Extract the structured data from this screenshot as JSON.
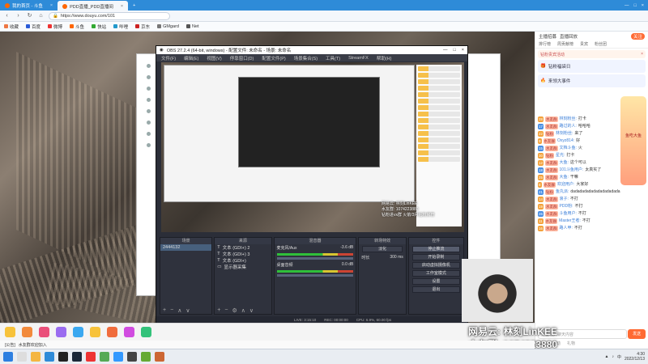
{
  "browser": {
    "tabs": [
      {
        "label": "我的首页 - 斗鱼",
        "active": false
      },
      {
        "label": "PDD直播_PDD直播间",
        "active": true
      }
    ],
    "url": "https://www.douyu.com/101",
    "bookmarks": [
      "收藏",
      "百度",
      "微博",
      "斗鱼",
      "快站",
      "哔哩",
      "京东",
      "GMgard",
      "Net"
    ]
  },
  "obs": {
    "title": "OBS 27.2.4 (64-bit, windows) - 配置文件: 未命名 - 场景: 未命名",
    "menu": [
      "文件(F)",
      "编辑(E)",
      "视图(V)",
      "停靠窗口(D)",
      "配置文件(P)",
      "场景集合(S)",
      "工具(T)",
      "StreamFX",
      "帮助(H)"
    ],
    "docks": {
      "scenes": {
        "header": "场景",
        "items": [
          "2444132"
        ]
      },
      "sources": {
        "header": "来源",
        "items": [
          "文本 (GDI+) 2",
          "文本 (GDI+) 3",
          "文本 (GDI+)",
          "显示器采集"
        ]
      },
      "mixer": {
        "header": "混音器",
        "items": [
          {
            "name": "麦克风/Aux",
            "db": "-3.6 dB"
          },
          {
            "name": "桌面音频",
            "db": "0.0 dB"
          }
        ]
      },
      "transitions": {
        "header": "转场特效",
        "type": "淡化",
        "duration_label": "时长",
        "duration": "300 ms"
      },
      "controls": {
        "header": "控件",
        "buttons": [
          "停止推流",
          "开始录制",
          "启动虚拟摄像机",
          "工作室模式",
          "设置",
          "退出"
        ]
      }
    },
    "status": [
      "LIVE: 3:15:10",
      "REC: 00:00:00",
      "CPU: 6.9%, 60.00 fps"
    ],
    "preview_text": [
      "网易云: 林刻LinKEE",
      "水友群: 1074223880",
      "钻粉进vx群 火箭/3月钻粉房管"
    ]
  },
  "chat": {
    "header": {
      "label": "主播招募",
      "button": "直播回放",
      "subscribe": "关注"
    },
    "tabs": [
      "排行榜",
      "周贡献榜",
      "贵宾",
      "粉丝团"
    ],
    "notice": "钻粉贵宾活动",
    "ad": "钻粉福袋日",
    "ad2": "来领大事件",
    "side_badge": "鱼吃大鱼",
    "messages": [
      {
        "lv": "28",
        "badge": "水友群",
        "nick": "林刻粉丝:",
        "text": "打卡"
      },
      {
        "lv": "17",
        "badge": "水友群",
        "nick": "路过的人:",
        "text": "哈哈哈"
      },
      {
        "lv": "22",
        "badge": "钻粉",
        "nick": "林刻粉丝:",
        "text": "来了"
      },
      {
        "lv": "9",
        "badge": "水友群",
        "nick": "Oxyz814:",
        "text": "好"
      },
      {
        "lv": "15",
        "badge": "水友群",
        "nick": "文档斗鱼:",
        "text": "火"
      },
      {
        "lv": "30",
        "badge": "钻粉",
        "nick": "星光:",
        "text": "打卡"
      },
      {
        "lv": "12",
        "badge": "水友群",
        "nick": "大鱼:",
        "text": "这个可以"
      },
      {
        "lv": "18",
        "badge": "水友群",
        "nick": "101斗鱼用户:",
        "text": "太真实了"
      },
      {
        "lv": "25",
        "badge": "水友群",
        "nick": "大鱼:",
        "text": "干嘛"
      },
      {
        "lv": "8",
        "badge": "水友群",
        "nick": "欢迎用户:",
        "text": "大家好"
      },
      {
        "lv": "21",
        "badge": "钻粉",
        "nick": "鱼丸派:",
        "text": "dadadadadadadadadadada"
      },
      {
        "lv": "14",
        "badge": "水友群",
        "nick": "浪子:",
        "text": "不打"
      },
      {
        "lv": "19",
        "badge": "水友群",
        "nick": "PDD粉:",
        "text": "不打"
      },
      {
        "lv": "26",
        "badge": "水友群",
        "nick": "斗鱼用户:",
        "text": "不打"
      },
      {
        "lv": "11",
        "badge": "水友群",
        "nick": "Master王者:",
        "text": "不打"
      },
      {
        "lv": "16",
        "badge": "水友群",
        "nick": "路人甲:",
        "text": "不打"
      }
    ],
    "input_placeholder": "这里输入聊天内容",
    "send": "发送",
    "footer": [
      "粉丝",
      "活动",
      "礼物"
    ]
  },
  "player": {
    "ticker_prefix": "[公告]",
    "ticker": "水友群欢迎加入"
  },
  "taskbar": {
    "time": "4:30",
    "date": "2022/12/13",
    "lang": "中"
  }
}
